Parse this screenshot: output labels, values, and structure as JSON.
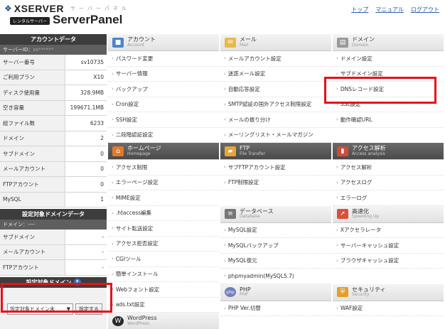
{
  "header": {
    "brand": "XSERVER",
    "sub": "サーバーパネル",
    "badge": "レンタルサーバー",
    "product": "ServerPanel",
    "links": [
      "トップ",
      "マニュアル",
      "ログアウト"
    ]
  },
  "sidebar": {
    "account_title": "アカウントデータ",
    "server_id_label": "サーバーID：",
    "server_id_value": "xs******",
    "rows": [
      {
        "k": "サーバー番号",
        "v": "sv10735"
      },
      {
        "k": "ご利用プラン",
        "v": "X10"
      },
      {
        "k": "ディスク使用量",
        "v": "328.9MB"
      },
      {
        "k": "空き容量",
        "v": "199671.1MB"
      },
      {
        "k": "総ファイル数",
        "v": "6233"
      },
      {
        "k": "ドメイン",
        "v": "2"
      },
      {
        "k": "サブドメイン",
        "v": "0"
      },
      {
        "k": "メールアカウント",
        "v": "0"
      },
      {
        "k": "FTPアカウント",
        "v": "0"
      },
      {
        "k": "MySQL",
        "v": "1"
      }
    ],
    "target_title": "設定対象ドメインデータ",
    "target_domain_label": "ドメイン：----",
    "target_rows": [
      {
        "k": "サブドメイン",
        "v": "-"
      },
      {
        "k": "メールアカウント",
        "v": "-"
      },
      {
        "k": "FTPアカウント",
        "v": "-"
      }
    ],
    "select_title": "設定対象ドメイン",
    "select_value": "設定対象ドメイン未",
    "select_button": "設定する"
  },
  "sections": {
    "account": {
      "name": "アカウント",
      "en": "Account",
      "items": [
        "パスワード変更",
        "サーバー情報",
        "バックアップ",
        "Cron設定",
        "SSH設定",
        "二段階認証設定"
      ]
    },
    "mail": {
      "name": "メール",
      "en": "Mail",
      "items": [
        "メールアカウント設定",
        "迷惑メール設定",
        "自動応答設定",
        "SMTP認証の国外アクセス制限設定",
        "メールの振り分け",
        "メーリングリスト・メールマガジン"
      ]
    },
    "domain": {
      "name": "ドメイン",
      "en": "Domain",
      "items": [
        "ドメイン設定",
        "サブドメイン設定",
        "DNSレコード設定",
        "SSL設定",
        "動作確認URL"
      ]
    },
    "homepage": {
      "name": "ホームページ",
      "en": "Homepage",
      "items": [
        "アクセス制限",
        "エラーページ設定",
        "MIME設定",
        ".htaccess編集",
        "サイト転送設定",
        "アクセス拒否設定",
        "CGIツール",
        "簡単インストール",
        "Webフォント設定",
        "ads.txt設定"
      ]
    },
    "ftp": {
      "name": "FTP",
      "en": "File Transfer",
      "items": [
        "サブFTPアカウント設定",
        "FTP制限設定"
      ]
    },
    "database": {
      "name": "データベース",
      "en": "Database",
      "items": [
        "MySQL設定",
        "MySQLバックアップ",
        "MySQL復元",
        "phpmyadmin(MySQL5.7)"
      ]
    },
    "php": {
      "name": "PHP",
      "en": "PHP",
      "items": [
        "PHP Ver.切替"
      ]
    },
    "analytics": {
      "name": "アクセス解析",
      "en": "Access analysis",
      "items": [
        "アクセス解析",
        "アクセスログ",
        "エラーログ"
      ]
    },
    "speed": {
      "name": "高速化",
      "en": "Speeding Up",
      "items": [
        "Xアクセラレータ",
        "サーバーキャッシュ設定",
        "ブラウザキャッシュ設定"
      ]
    },
    "security": {
      "name": "セキュリティ",
      "en": "Security",
      "items": [
        "WAF設定"
      ]
    },
    "wordpress": {
      "name": "WordPress",
      "en": "WordPress",
      "items": []
    }
  },
  "colors": {
    "highlight": "#e8101a",
    "link": "#2a5caa",
    "header_bg": "#3d3d3d"
  }
}
